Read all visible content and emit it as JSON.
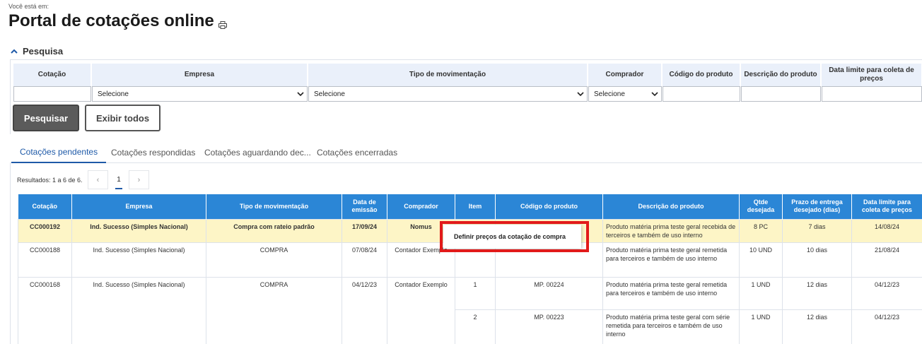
{
  "breadcrumb": "Você está em:",
  "page_title": "Portal de cotações online",
  "search_section": {
    "label": "Pesquisa"
  },
  "filters": {
    "headers": [
      "Cotação",
      "Empresa",
      "Tipo de movimentação",
      "Comprador",
      "Código do produto",
      "Descrição do produto",
      "Data limite para coleta de preços"
    ],
    "select_placeholder": "Selecione"
  },
  "buttons": {
    "search": "Pesquisar",
    "show_all": "Exibir todos"
  },
  "tabs": [
    "Cotações pendentes",
    "Cotações respondidas",
    "Cotações aguardando dec...",
    "Cotações encerradas"
  ],
  "results": {
    "text": "Resultados: 1 a 6 de 6.",
    "prev": "‹",
    "page": "1",
    "next": "›"
  },
  "table": {
    "columns": [
      "Cotação",
      "Empresa",
      "Tipo de movimentação",
      "Data de emissão",
      "Comprador",
      "Item",
      "Código do produto",
      "Descrição do produto",
      "Qtde desejada",
      "Prazo de entrega desejado (dias)",
      "Data limite para coleta de preços"
    ],
    "rows": [
      {
        "cotacao": "CC000192",
        "empresa": "Ind. Sucesso (Simples Nacional)",
        "tipo": "Compra com rateio padrão",
        "data": "17/09/24",
        "comprador": "Nomus",
        "items": [
          {
            "item": "",
            "codigo": "",
            "descricao": "Produto matéria prima teste geral recebida de terceiros e também de uso interno",
            "qtde": "8 PC",
            "prazo": "7 dias",
            "limite": "14/08/24"
          }
        ]
      },
      {
        "cotacao": "CC000188",
        "empresa": "Ind. Sucesso (Simples Nacional)",
        "tipo": "COMPRA",
        "data": "07/08/24",
        "comprador": "Contador Exemplo",
        "items": [
          {
            "item": "",
            "codigo": "",
            "descricao": "Produto matéria prima teste geral remetida para terceiros e também de uso interno",
            "qtde": "10 UND",
            "prazo": "10 dias",
            "limite": "21/08/24"
          }
        ]
      },
      {
        "cotacao": "CC000168",
        "empresa": "Ind. Sucesso (Simples Nacional)",
        "tipo": "COMPRA",
        "data": "04/12/23",
        "comprador": "Contador Exemplo",
        "items": [
          {
            "item": "1",
            "codigo": "MP. 00224",
            "descricao": "Produto matéria prima teste geral remetida para terceiros e também de uso interno",
            "qtde": "1 UND",
            "prazo": "12 dias",
            "limite": "04/12/23"
          },
          {
            "item": "2",
            "codigo": "MP. 00223",
            "descricao": "Produto matéria prima teste geral com série remetida para terceiros e também de uso interno",
            "qtde": "1 UND",
            "prazo": "12 dias",
            "limite": "04/12/23"
          }
        ]
      }
    ]
  },
  "context_menu": {
    "item": "Definir preços da cotação de compra"
  }
}
